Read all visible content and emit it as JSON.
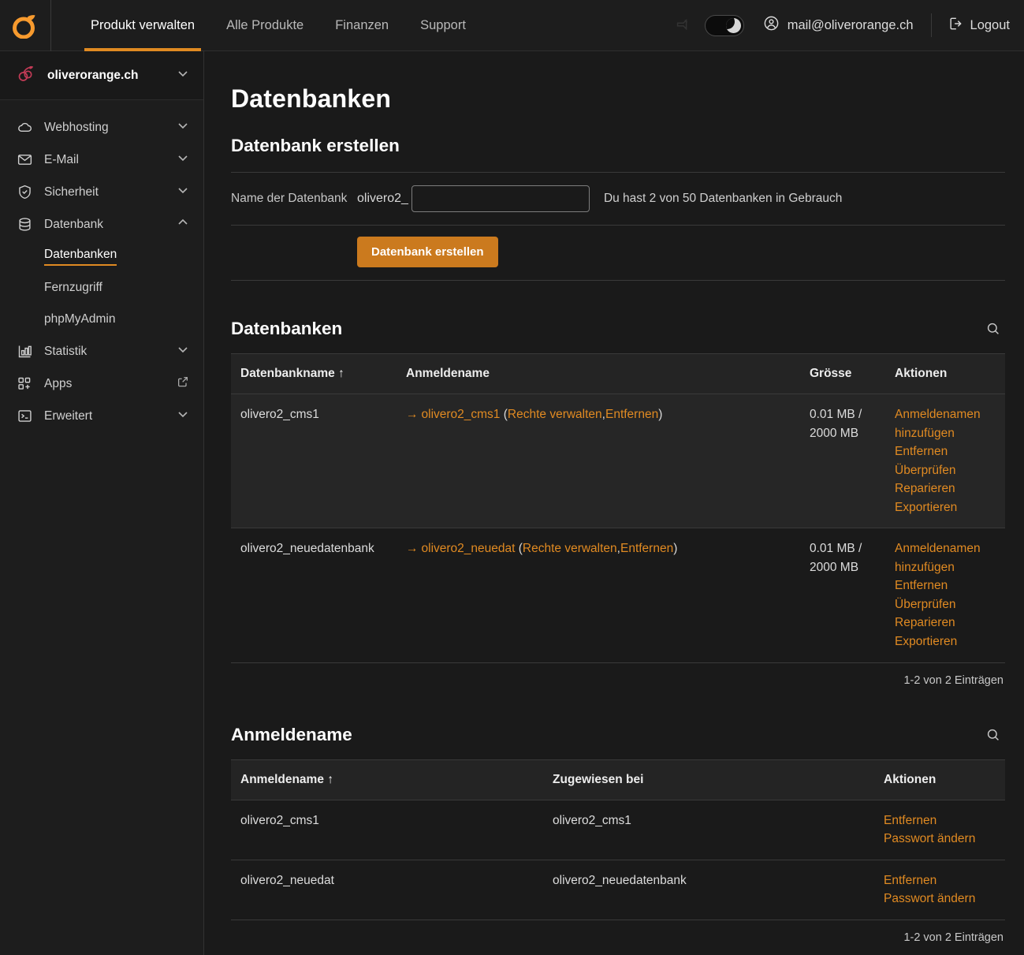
{
  "colors": {
    "accent": "#e08a22",
    "button": "#cb7a1e",
    "brand_logo": "#f79a2e",
    "domain_icon": "#c23b56",
    "page_bg": "#1a1a1a",
    "panel_bg": "#1d1d1d",
    "row_highlight": "#262626",
    "border": "#3a3a3a"
  },
  "topbar": {
    "logo_icon": "orange-logo-icon",
    "nav": [
      {
        "label": "Produkt verwalten",
        "active": true
      },
      {
        "label": "Alle Produkte",
        "active": false
      },
      {
        "label": "Finanzen",
        "active": false
      },
      {
        "label": "Support",
        "active": false
      }
    ],
    "dim_icon": "faded-status-icon",
    "theme_toggle": {
      "icon": "moon-icon",
      "state": "dark",
      "on": true
    },
    "user": {
      "icon": "user-circle-icon",
      "email": "mail@oliverorange.ch"
    },
    "logout": {
      "icon": "logout-icon",
      "label": "Logout"
    }
  },
  "sidebar": {
    "domain": {
      "icon": "cherries-icon",
      "name": "oliverorange.ch",
      "chevron": "chevron-down-icon"
    },
    "items": [
      {
        "label": "Webhosting",
        "icon": "cloud-icon",
        "chevron": "chevron-down-icon",
        "expanded": false
      },
      {
        "label": "E-Mail",
        "icon": "envelope-icon",
        "chevron": "chevron-down-icon",
        "expanded": false
      },
      {
        "label": "Sicherheit",
        "icon": "shield-check-icon",
        "chevron": "chevron-down-icon",
        "expanded": false
      },
      {
        "label": "Datenbank",
        "icon": "database-icon",
        "chevron": "chevron-up-icon",
        "expanded": true
      }
    ],
    "sub_items": [
      {
        "label": "Datenbanken",
        "active": true
      },
      {
        "label": "Fernzugriff",
        "active": false
      },
      {
        "label": "phpMyAdmin",
        "active": false
      }
    ],
    "items_after": [
      {
        "label": "Statistik",
        "icon": "chart-bars-icon",
        "chevron": "chevron-down-icon"
      },
      {
        "label": "Apps",
        "icon": "apps-grid-plus-icon",
        "chevron": "external-link-icon"
      },
      {
        "label": "Erweitert",
        "icon": "terminal-icon",
        "chevron": "chevron-down-icon"
      }
    ]
  },
  "main": {
    "page_title": "Datenbanken",
    "create": {
      "title": "Datenbank erstellen",
      "field_label": "Name der Datenbank",
      "prefix": "olivero2_",
      "input_value": "",
      "input_placeholder": "",
      "quota_text": "Du hast 2 von 50 Datenbanken in Gebrauch",
      "submit_label": "Datenbank erstellen"
    },
    "db_section": {
      "title": "Datenbanken",
      "search_icon": "search-icon",
      "columns": [
        "Datenbankname ↑",
        "Anmeldename",
        "Grösse",
        "Aktionen"
      ],
      "rows": [
        {
          "name": "olivero2_cms1",
          "login_arrow": "→",
          "login_name": "olivero2_cms1",
          "login_open": " (",
          "login_manage": "Rechte verwalten",
          "login_sep": ",",
          "login_remove": "Entfernen",
          "login_close": ")",
          "size": "0.01 MB / 2000 MB",
          "actions": [
            "Anmeldenamen hinzufügen",
            "Entfernen",
            "Überprüfen",
            "Reparieren",
            "Exportieren"
          ],
          "highlighted": true
        },
        {
          "name": "olivero2_neuedatenbank",
          "login_arrow": "→",
          "login_name": "olivero2_neuedat",
          "login_open": " (",
          "login_manage": "Rechte verwalten",
          "login_sep": ",",
          "login_remove": "Entfernen",
          "login_close": ")",
          "size": "0.01 MB / 2000 MB",
          "actions": [
            "Anmeldenamen hinzufügen",
            "Entfernen",
            "Überprüfen",
            "Reparieren",
            "Exportieren"
          ],
          "highlighted": false
        }
      ],
      "pager": "1-2 von 2 Einträgen"
    },
    "login_section": {
      "title": "Anmeldename",
      "search_icon": "search-icon",
      "columns": [
        "Anmeldename ↑",
        "Zugewiesen bei",
        "Aktionen"
      ],
      "rows": [
        {
          "name": "olivero2_cms1",
          "assigned": "olivero2_cms1",
          "actions": [
            "Entfernen",
            "Passwort ändern"
          ]
        },
        {
          "name": "olivero2_neuedat",
          "assigned": "olivero2_neuedatenbank",
          "actions": [
            "Entfernen",
            "Passwort ändern"
          ]
        }
      ],
      "pager": "1-2 von 2 Einträgen"
    }
  }
}
